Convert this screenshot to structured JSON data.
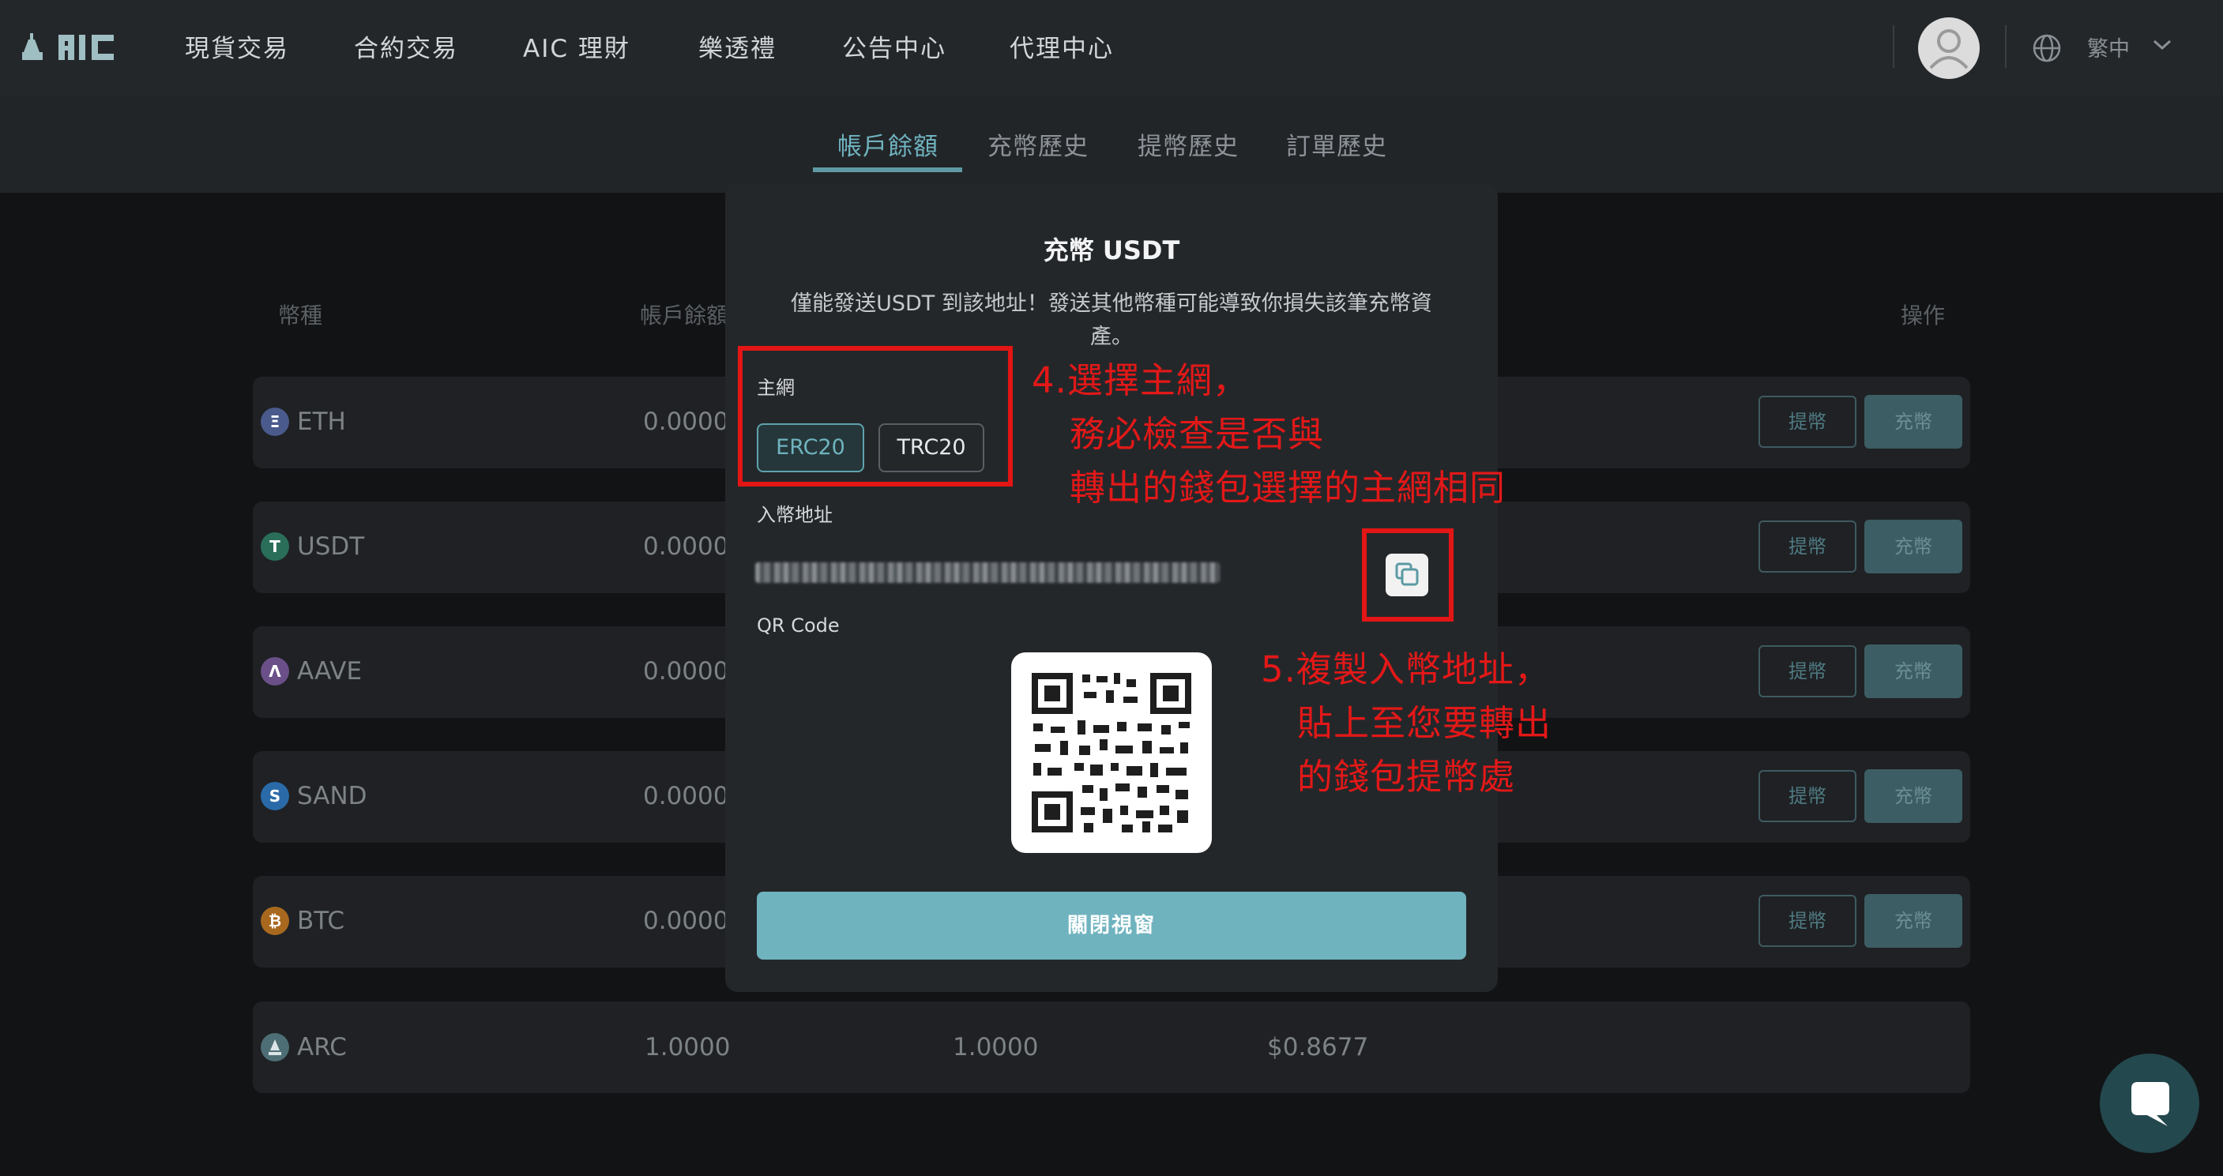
{
  "nav": {
    "items": [
      "現貨交易",
      "合約交易",
      "AIC 理財",
      "樂透禮",
      "公告中心",
      "代理中心"
    ],
    "language": "繁中"
  },
  "tabs": [
    "帳戶餘額",
    "充幣歷史",
    "提幣歷史",
    "訂單歷史"
  ],
  "table": {
    "headers": {
      "coin": "幣種",
      "balance": "帳戶餘額",
      "action": "操作"
    },
    "withdraw_label": "提幣",
    "deposit_label": "充幣",
    "rows": [
      {
        "coin": "ETH",
        "balance": "0.0000",
        "icon": "Ξ",
        "color": "#627eea"
      },
      {
        "coin": "USDT",
        "balance": "0.0000",
        "icon": "T",
        "color": "#26a17b"
      },
      {
        "coin": "AAVE",
        "balance": "0.0000",
        "icon": "Λ",
        "color": "#8f63c5"
      },
      {
        "coin": "SAND",
        "balance": "0.0000",
        "icon": "S",
        "color": "#1c8ef0"
      },
      {
        "coin": "BTC",
        "balance": "0.0000",
        "icon": "₿",
        "color": "#f7931a"
      }
    ],
    "arc_row": {
      "coin": "ARC",
      "balance": "1.0000",
      "available": "1.0000",
      "value": "$0.8677"
    }
  },
  "modal": {
    "title": "充幣 USDT",
    "warning": "僅能發送USDT 到該地址！發送其他幣種可能導致你損失該筆充幣資產。",
    "network_label": "主網",
    "networks": [
      "ERC20",
      "TRC20"
    ],
    "selected_network": "ERC20",
    "address_label": "入幣地址",
    "qr_label": "QR Code",
    "close_label": "關閉視窗"
  },
  "annotations": {
    "step4": [
      "4.選擇主網，",
      "務必檢查是否與",
      "轉出的錢包選擇的主網相同"
    ],
    "step5": [
      "5.複製入幣地址，",
      "貼上至您要轉出",
      "的錢包提幣處"
    ],
    "color": "#e31818"
  }
}
